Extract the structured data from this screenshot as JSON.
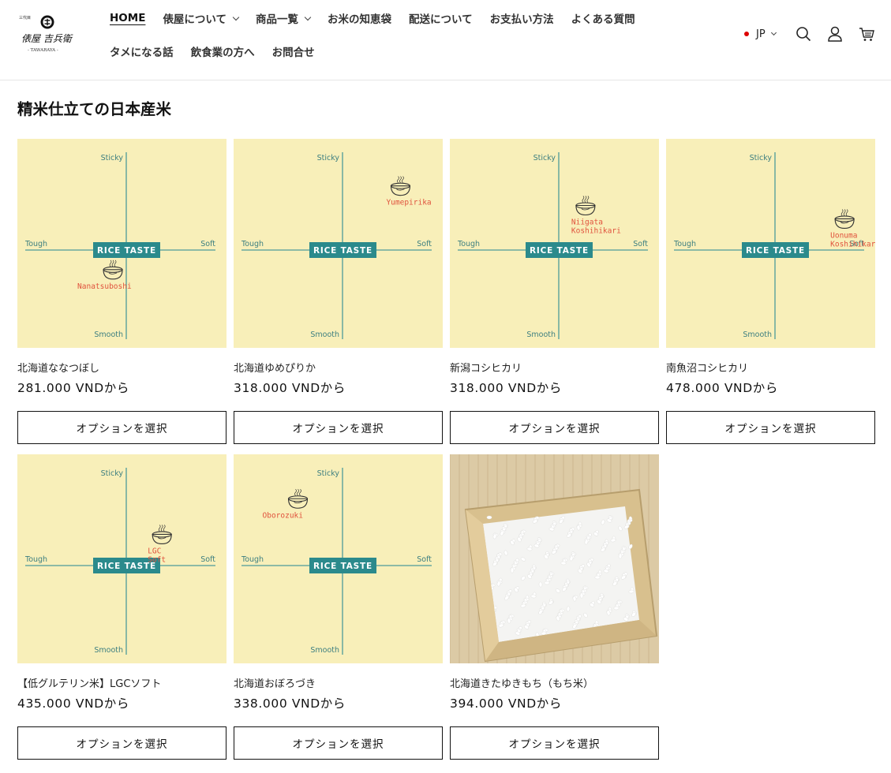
{
  "brand": {
    "name": "俵屋吉兵衛",
    "subtitle": "- TAWARAYA -"
  },
  "nav": {
    "row1": [
      {
        "label": "HOME",
        "active": true,
        "dropdown": false
      },
      {
        "label": "俵屋について",
        "active": false,
        "dropdown": true
      },
      {
        "label": "商品一覧",
        "active": false,
        "dropdown": true
      },
      {
        "label": "お米の知恵袋",
        "active": false,
        "dropdown": false
      },
      {
        "label": "配送について",
        "active": false,
        "dropdown": false
      },
      {
        "label": "お支払い方法",
        "active": false,
        "dropdown": false
      },
      {
        "label": "よくある質問",
        "active": false,
        "dropdown": false
      }
    ],
    "row2": [
      {
        "label": "タメになる話"
      },
      {
        "label": "飲食業の方へ"
      },
      {
        "label": "お問合せ"
      }
    ]
  },
  "utility": {
    "language": "JP",
    "icons": [
      "search-icon",
      "account-icon",
      "cart-icon"
    ]
  },
  "section": {
    "title": "精米仕立ての日本産米"
  },
  "chart_labels": {
    "top": "Sticky",
    "bottom": "Smooth",
    "left": "Tough",
    "right": "Soft",
    "center": "RICE TASTE"
  },
  "products": [
    {
      "title": "北海道ななつぼし",
      "price": "281.000 VNDから",
      "button": "オプションを選択",
      "image": "chart",
      "marker": {
        "label": "Nanatsuboshi",
        "softness": -0.15,
        "stickiness": -0.22
      }
    },
    {
      "title": "北海道ゆめぴりか",
      "price": "318.000 VNDから",
      "button": "オプションを選択",
      "image": "chart",
      "marker": {
        "label": "Yumepirika",
        "softness": 0.65,
        "stickiness": 0.72
      }
    },
    {
      "title": "新潟コシヒカリ",
      "price": "318.000 VNDから",
      "button": "オプションを選択",
      "image": "chart",
      "marker": {
        "label": "Niigata Koshihikari",
        "softness": 0.3,
        "stickiness": 0.5
      }
    },
    {
      "title": "南魚沼コシヒカリ",
      "price": "478.000 VNDから",
      "button": "オプションを選択",
      "image": "chart",
      "marker": {
        "label": "Uonuma Koshihikari",
        "softness": 0.78,
        "stickiness": 0.35
      }
    },
    {
      "title": "【低グルテリン米】LGCソフト",
      "price": "435.000 VNDから",
      "button": "オプションを選択",
      "image": "chart",
      "marker": {
        "label": "LGC Soft",
        "softness": 0.4,
        "stickiness": 0.35
      }
    },
    {
      "title": "北海道おぼろづき",
      "price": "338.000 VNDから",
      "button": "オプションを選択",
      "image": "chart",
      "marker": {
        "label": "Oborozuki",
        "softness": -0.5,
        "stickiness": 0.75
      }
    },
    {
      "title": "北海道きたゆきもち（もち米）",
      "price": "394.000 VNDから",
      "button": "オプションを選択",
      "image": "photo"
    }
  ]
}
